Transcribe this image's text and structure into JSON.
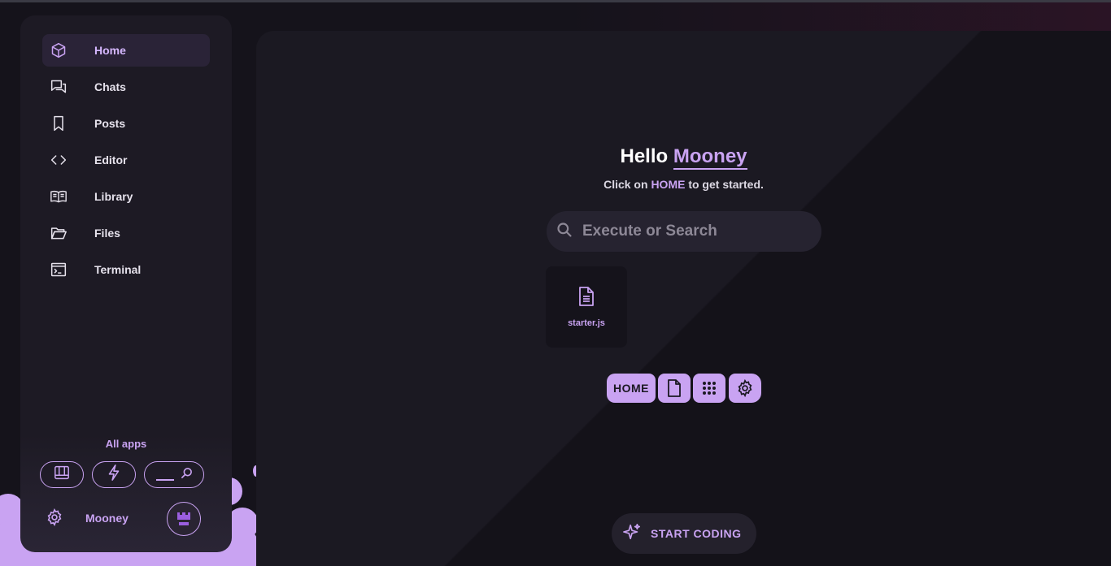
{
  "sidebar": {
    "items": [
      {
        "label": "Home",
        "icon": "cube-icon",
        "active": true
      },
      {
        "label": "Chats",
        "icon": "chats-icon",
        "active": false
      },
      {
        "label": "Posts",
        "icon": "bookmark-icon",
        "active": false
      },
      {
        "label": "Editor",
        "icon": "code-icon",
        "active": false
      },
      {
        "label": "Library",
        "icon": "book-icon",
        "active": false
      },
      {
        "label": "Files",
        "icon": "folder-icon",
        "active": false
      },
      {
        "label": "Terminal",
        "icon": "terminal-icon",
        "active": false
      }
    ],
    "all_apps_label": "All apps",
    "quick_buttons": [
      "board-icon",
      "bolt-icon",
      "search-icon"
    ],
    "user": {
      "name": "Mooney"
    }
  },
  "main": {
    "greeting_prefix": "Hello",
    "greeting_name": "Mooney",
    "subtitle_pre": "Click on",
    "subtitle_highlight": "HOME",
    "subtitle_post": "to get started.",
    "search_placeholder": "Execute or Search",
    "file": {
      "name": "starter.js"
    },
    "toolbar": {
      "home_label": "HOME"
    },
    "start_label": "START CODING"
  },
  "colors": {
    "accent": "#c9a3f2",
    "background": "#15131b",
    "panel": "#1b1922",
    "sidebar": "#1d1a24"
  }
}
